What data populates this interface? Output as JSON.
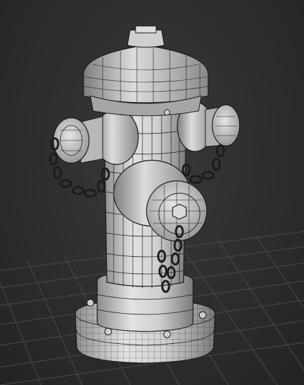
{
  "viewport": {
    "background_color": "#2b2b2b",
    "grid_color": "#4a4a4a",
    "mesh_fill_color": "#cfcfcf",
    "wire_color": "#1a1a1a"
  },
  "scene": {
    "object": "fire-hydrant-wireframe",
    "render_mode": "shaded-with-wireframe",
    "grid_visible": true
  }
}
